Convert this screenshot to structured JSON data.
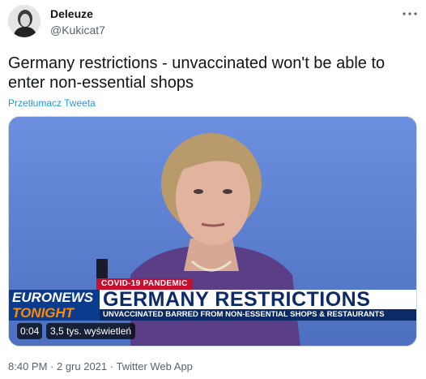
{
  "author": {
    "name": "Deleuze",
    "handle": "@Kukicat7",
    "avatar": "avatar-portrait"
  },
  "more_icon": "more-dots-icon",
  "tweet": {
    "text": "Germany restrictions - unvaccinated won't be able to enter non-essential shops",
    "translate": "Przetłumacz Tweeta"
  },
  "video": {
    "badge": "COVID-19 PANDEMIC",
    "logo_line1": "EURONEWS",
    "logo_line2": "TONIGHT",
    "headline": "GERMANY RESTRICTIONS",
    "subheadline": "UNVACCINATED BARRED FROM NON-ESSENTIAL SHOPS & RESTAURANTS",
    "time": "0:04",
    "views": "3,5 tys. wyświetleń"
  },
  "meta": {
    "time": "8:40 PM",
    "sep1": " · ",
    "date": "2 gru 2021",
    "sep2": " · ",
    "source": "Twitter Web App"
  },
  "colors": {
    "link": "#1d9bf0",
    "secondary_text": "#536471",
    "video_background": "#5b7fd0",
    "badge": "#c8102e",
    "banner_navy": "#0b2a66"
  }
}
